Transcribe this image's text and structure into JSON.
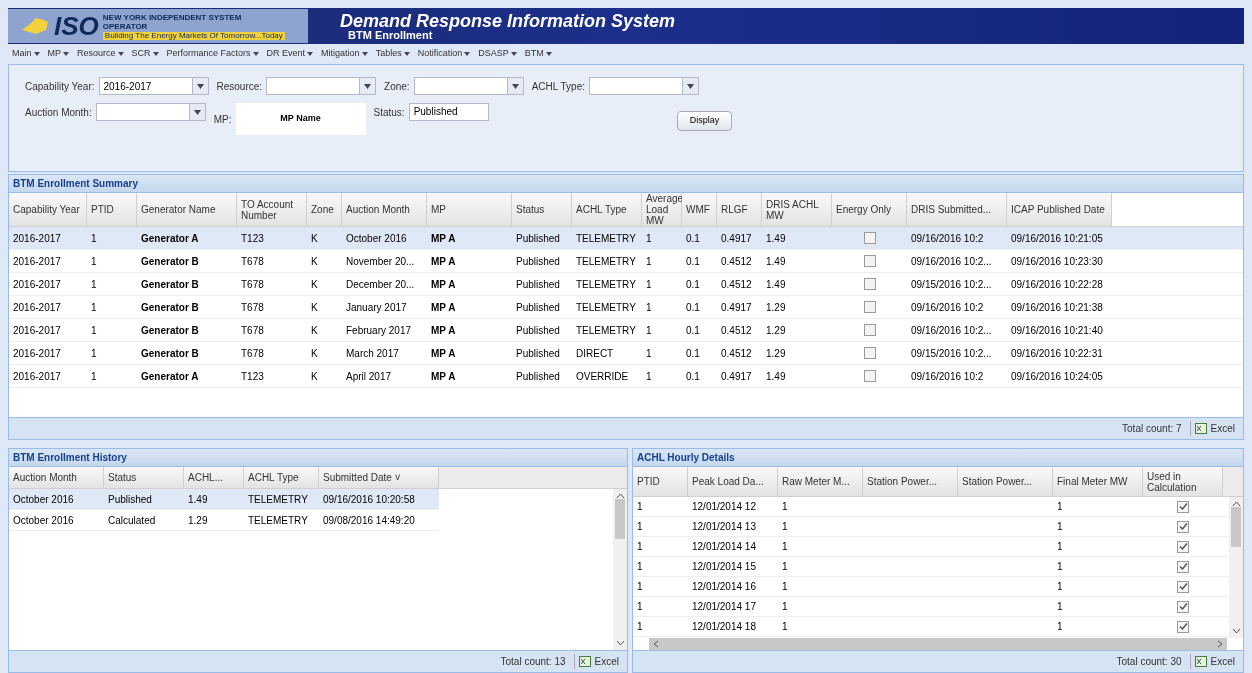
{
  "header": {
    "logo_text": "ISO",
    "logo_subtitle": "NEW YORK INDEPENDENT SYSTEM OPERATOR",
    "logo_tagline": "Building The Energy Markets Of Tomorrow...Today",
    "title": "Demand Response Information System",
    "subtitle": "BTM Enrollment"
  },
  "menu": [
    "Main",
    "MP",
    "Resource",
    "SCR",
    "Performance Factors",
    "DR Event",
    "Mitigation",
    "Tables",
    "Notification",
    "DSASP",
    "BTM"
  ],
  "filters": [
    {
      "label": "Capability Year:",
      "value": "2016-2017",
      "kind": "select"
    },
    {
      "label": "Resource:",
      "kind": "select"
    },
    {
      "label": "Zone:",
      "kind": "select"
    },
    {
      "label": "ACHL Type:",
      "kind": "select"
    },
    {
      "label": "Auction Month:",
      "kind": "select"
    },
    {
      "label": "MP:",
      "value": "MP Name",
      "kind": "text"
    },
    {
      "label": "Status:",
      "value": "Published",
      "kind": "text"
    }
  ],
  "display_button": "Display",
  "summary": {
    "title": "BTM Enrollment Summary",
    "columns": [
      "Capability Year",
      "PTID",
      "Generator Name",
      "TO Account Number",
      "Zone",
      "Auction Month",
      "MP",
      "Status",
      "ACHL Type",
      "Average Load MW",
      "WMF",
      "RLGF",
      "DRIS ACHL MW",
      "Energy Only",
      "DRIS Submitted...",
      "ICAP Published Date"
    ],
    "rows": [
      {
        "selected": true,
        "energy_only": false,
        "cells": [
          "2016-2017",
          "1",
          "Generator A",
          "T123",
          "K",
          "October 2016",
          "MP A",
          "Published",
          "TELEMETRY",
          "1",
          "0.1",
          "0.4917",
          "1.49",
          "",
          "09/16/2016 10:2",
          "09/16/2016 10:21:05"
        ]
      },
      {
        "selected": false,
        "energy_only": false,
        "cells": [
          "2016-2017",
          "1",
          "Generator B",
          "T678",
          "K",
          "November 20...",
          "MP A",
          "Published",
          "TELEMETRY",
          "1",
          "0.1",
          "0.4512",
          "1.49",
          "",
          "09/16/2016 10:2...",
          "09/16/2016 10:23:30"
        ]
      },
      {
        "selected": false,
        "energy_only": false,
        "cells": [
          "2016-2017",
          "1",
          "Generator B",
          "T678",
          "K",
          "December 20...",
          "MP A",
          "Published",
          "TELEMETRY",
          "1",
          "0.1",
          "0.4512",
          "1.49",
          "",
          "09/15/2016 10:2...",
          "09/16/2016 10:22:28"
        ]
      },
      {
        "selected": false,
        "energy_only": false,
        "cells": [
          "2016-2017",
          "1",
          "Generator B",
          "T678",
          "K",
          "January 2017",
          "MP A",
          "Published",
          "TELEMETRY",
          "1",
          "0.1",
          "0.4917",
          "1.29",
          "",
          "09/16/2016 10:2",
          "09/16/2016 10:21:38"
        ]
      },
      {
        "selected": false,
        "energy_only": false,
        "cells": [
          "2016-2017",
          "1",
          "Generator B",
          "T678",
          "K",
          "February 2017",
          "MP A",
          "Published",
          "TELEMETRY",
          "1",
          "0.1",
          "0.4512",
          "1.29",
          "",
          "09/16/2016 10:2...",
          "09/16/2016 10:21:40"
        ]
      },
      {
        "selected": false,
        "energy_only": false,
        "cells": [
          "2016-2017",
          "1",
          "Generator B",
          "T678",
          "K",
          "March 2017",
          "MP A",
          "Published",
          "DIRECT",
          "1",
          "0.1",
          "0.4512",
          "1.29",
          "",
          "09/15/2016 10:2...",
          "09/16/2016 10:22:31"
        ]
      },
      {
        "selected": false,
        "energy_only": false,
        "cells": [
          "2016-2017",
          "1",
          "Generator A",
          "T123",
          "K",
          "April 2017",
          "MP A",
          "Published",
          "OVERRIDE",
          "1",
          "0.1",
          "0.4917",
          "1.49",
          "",
          "09/16/2016 10:2",
          "09/16/2016 10:24:05"
        ]
      }
    ],
    "total": "Total count: 7",
    "excel": "Excel"
  },
  "history": {
    "title": "BTM Enrollment History",
    "columns": [
      "Auction Month",
      "Status",
      "ACHL...",
      "ACHL Type",
      "Submitted Date ˅"
    ],
    "rows": [
      {
        "selected": true,
        "cells": [
          "October 2016",
          "Published",
          "1.49",
          "TELEMETRY",
          "09/16/2016 10:20:58"
        ]
      },
      {
        "selected": false,
        "cells": [
          "October 2016",
          "Calculated",
          "1.29",
          "TELEMETRY",
          "09/08/2016 14:49:20"
        ]
      }
    ],
    "total": "Total count: 13",
    "excel": "Excel"
  },
  "hourly": {
    "title": "ACHL Hourly Details",
    "columns": [
      "PTID",
      "Peak Load Da...",
      "Raw Meter M...",
      "Station Power...",
      "Station Power...",
      "Final Meter MW",
      "Used in Calculation"
    ],
    "rows": [
      {
        "used": true,
        "cells": [
          "1",
          "12/01/2014 12",
          "1",
          "",
          "",
          "1"
        ]
      },
      {
        "used": true,
        "cells": [
          "1",
          "12/01/2014 13",
          "1",
          "",
          "",
          "1"
        ]
      },
      {
        "used": true,
        "cells": [
          "1",
          "12/01/2014 14",
          "1",
          "",
          "",
          "1"
        ]
      },
      {
        "used": true,
        "cells": [
          "1",
          "12/01/2014 15",
          "1",
          "",
          "",
          "1"
        ]
      },
      {
        "used": true,
        "cells": [
          "1",
          "12/01/2014 16",
          "1",
          "",
          "",
          "1"
        ]
      },
      {
        "used": true,
        "cells": [
          "1",
          "12/01/2014 17",
          "1",
          "",
          "",
          "1"
        ]
      },
      {
        "used": true,
        "cells": [
          "1",
          "12/01/2014 18",
          "1",
          "",
          "",
          "1"
        ]
      }
    ],
    "total": "Total count: 30",
    "excel": "Excel"
  }
}
